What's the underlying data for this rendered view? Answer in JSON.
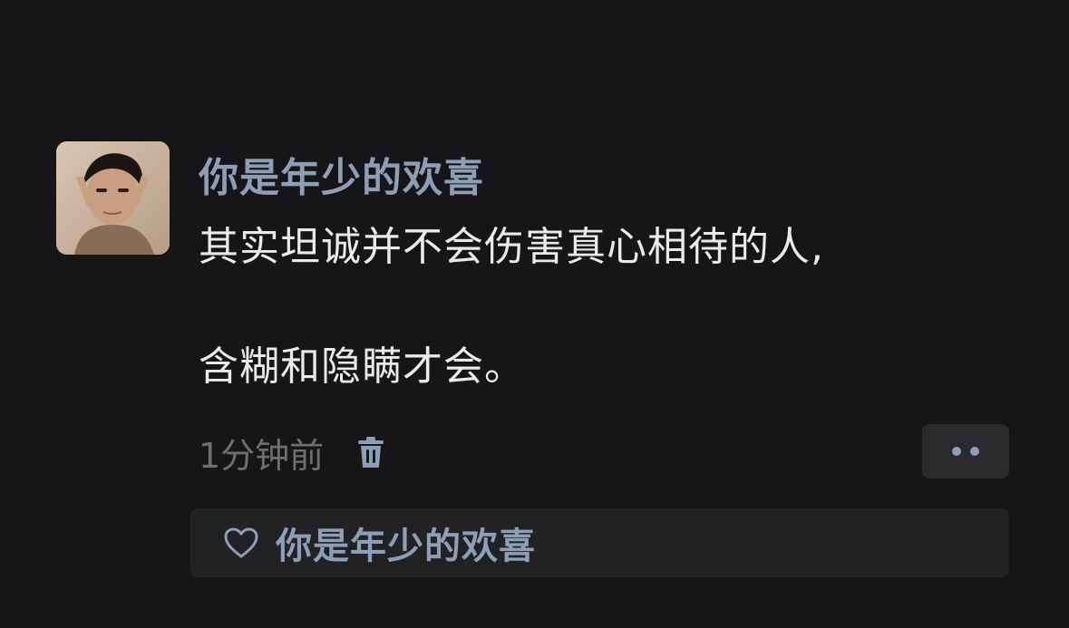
{
  "comment": {
    "author": "你是年少的欢喜",
    "lines": [
      "其实坦诚并不会伤害真心相待的人,",
      "",
      "含糊和隐瞒才会。"
    ],
    "timestamp": "1分钟前"
  },
  "icons": {
    "avatar": "avatar-photo",
    "delete": "trash-icon",
    "more": "more-dots-icon",
    "like": "heart-icon"
  },
  "likes": {
    "names": "你是年少的欢喜"
  },
  "colors": {
    "background": "#161618",
    "name_accent": "#8c9fb6",
    "body_text": "#eaeaea",
    "muted_text": "#6f6f72",
    "panel": "#222225",
    "button": "#2a2a2d"
  }
}
